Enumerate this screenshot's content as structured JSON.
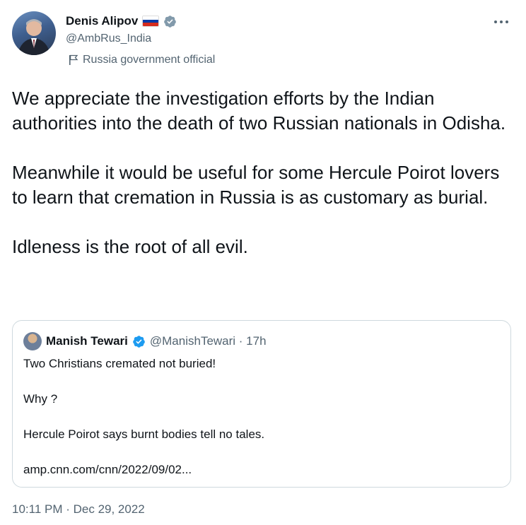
{
  "author": {
    "display_name": "Denis Alipov",
    "handle": "@AmbRus_India",
    "label": "Russia government official"
  },
  "tweet": {
    "text": "We appreciate the investigation efforts by the Indian authorities into the death of two Russian nationals in Odisha.\n\nMeanwhile it would be useful for some Hercule Poirot lovers to learn that cremation in Russia is as customary as burial.\n\nIdleness is the root of all evil.",
    "timestamp": "10:11 PM · Dec 29, 2022"
  },
  "quote": {
    "display_name": "Manish Tewari",
    "meta": "@ManishTewari · 17h",
    "text": "Two Christians cremated not buried!\n\nWhy ?\n\nHercule Poirot says burnt bodies tell no tales.\n\namp.cnn.com/cnn/2022/09/02..."
  },
  "icons": {
    "verified": "verified-badge-icon",
    "flag": "russia-flag-icon",
    "label": "government-flag-icon",
    "more": "more-options-icon"
  },
  "colors": {
    "verified_user": "#829aab",
    "verified_quote": "#1d9bf0",
    "secondary_text": "#536471",
    "border": "#cfd9de"
  }
}
